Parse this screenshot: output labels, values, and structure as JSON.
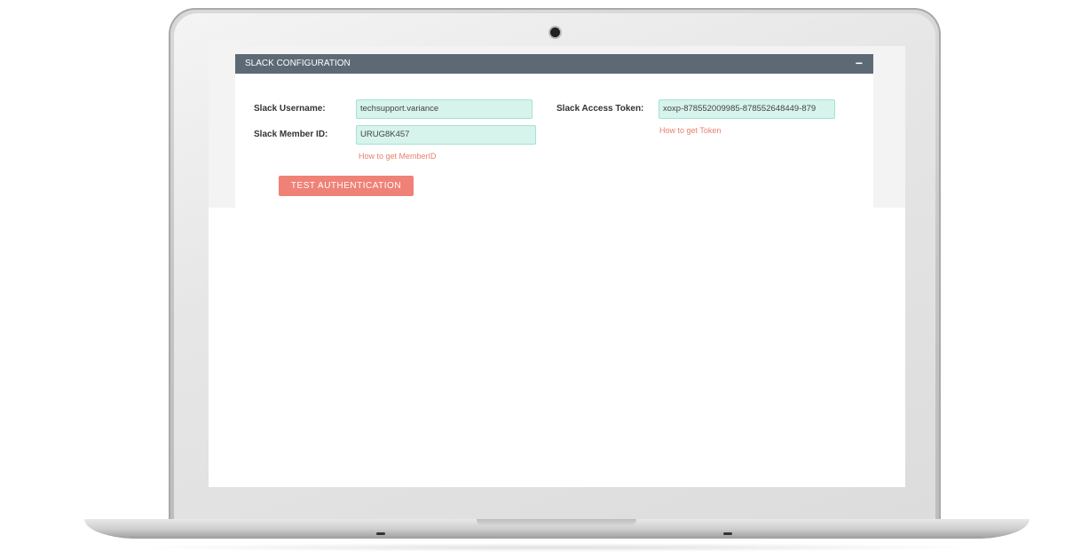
{
  "panel": {
    "title": "SLACK CONFIGURATION",
    "collapse_symbol": "−"
  },
  "form": {
    "username_label": "Slack Username:",
    "username_value": "techsupport.variance",
    "member_id_label": "Slack Member ID:",
    "member_id_value": "URUG8K457",
    "member_id_help": "How to get MemberID",
    "token_label": "Slack Access Token:",
    "token_value": "xoxp-878552009985-878552648449-879",
    "token_help": "How to get Token"
  },
  "actions": {
    "test_auth_label": "TEST AUTHENTICATION"
  },
  "colors": {
    "header_bg": "#5d6a76",
    "input_bg": "#d6f3ec",
    "accent": "#f08176",
    "link": "#e87f6f"
  }
}
